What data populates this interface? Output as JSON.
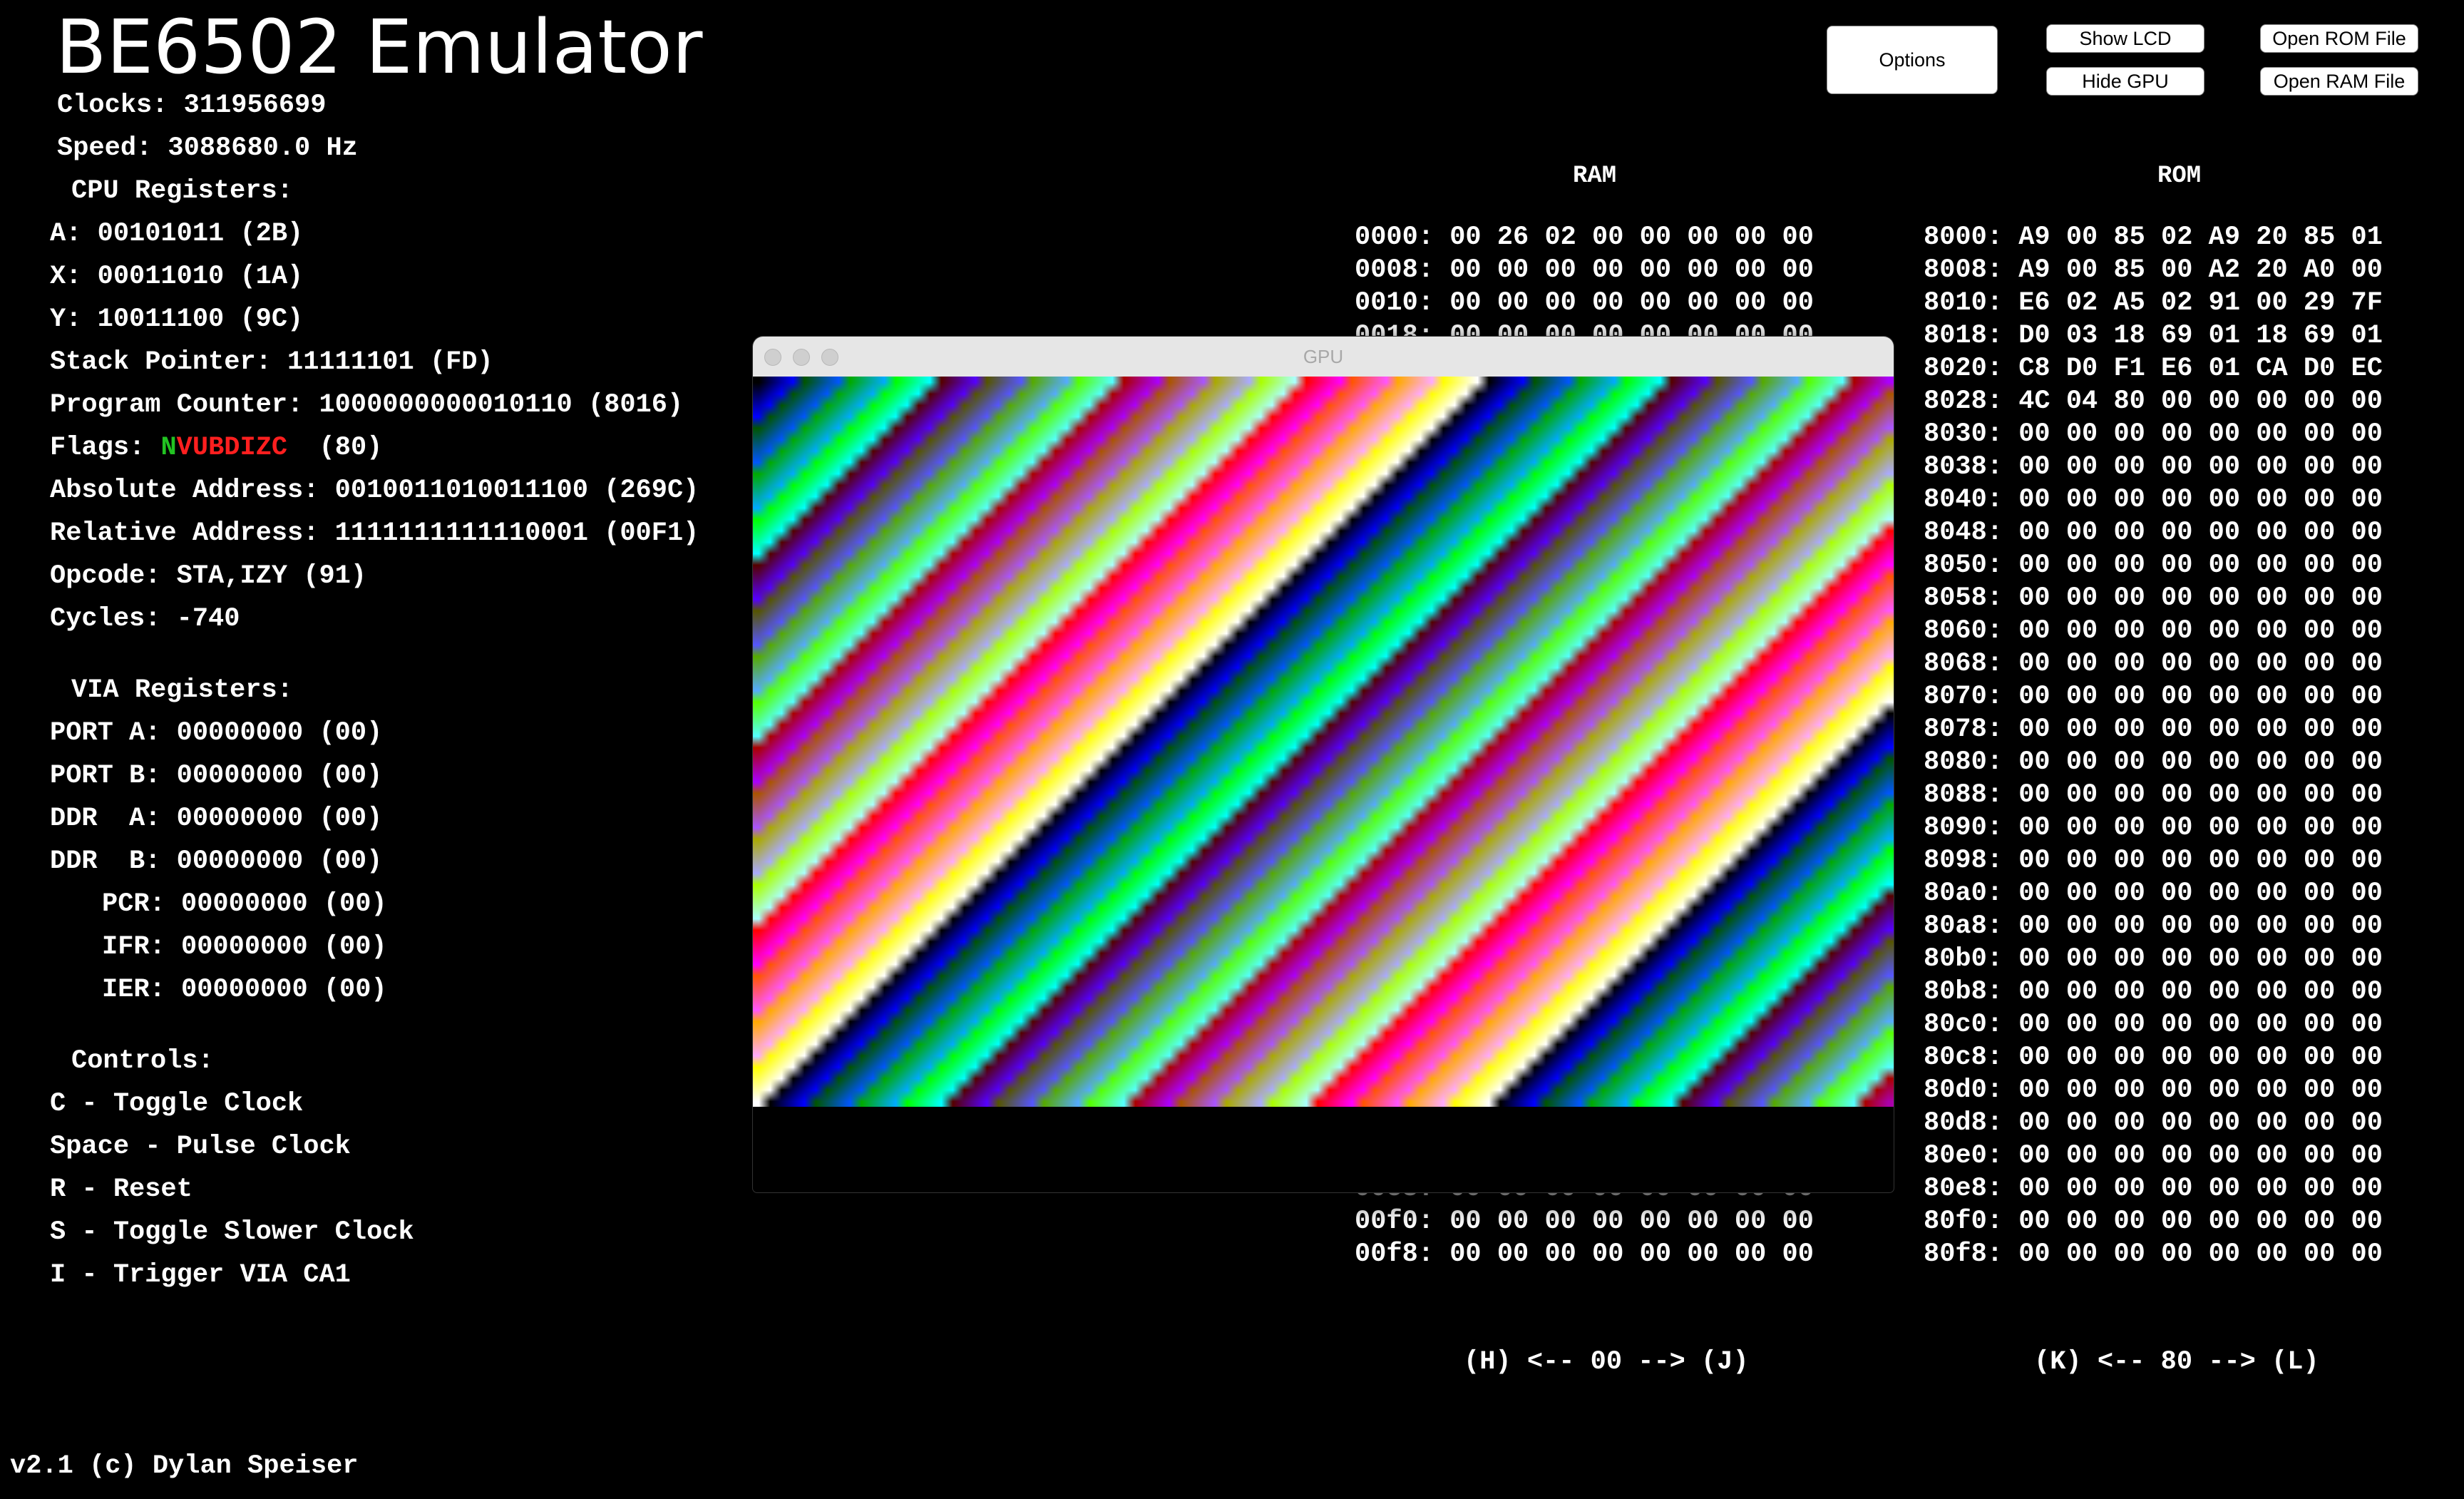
{
  "app": {
    "title": "BE6502 Emulator",
    "clocks_line": "Clocks: 311956699",
    "speed_line": "Speed: 3088680.0 Hz",
    "footer": "v2.1 (c) Dylan Speiser"
  },
  "buttons": {
    "options": "Options",
    "show_lcd": "Show LCD",
    "hide_gpu": "Hide GPU",
    "open_rom": "Open ROM File",
    "open_ram": "Open RAM File"
  },
  "cpu": {
    "heading": "CPU Registers:",
    "a": "A: 00101011 (2B)",
    "x": "X: 00011010 (1A)",
    "y": "Y: 10011100 (9C)",
    "sp": "Stack Pointer: 11111101 (FD)",
    "pc": "Program Counter: 1000000000010110 (8016)",
    "flags_label": "Flags:",
    "flags_set": "N",
    "flags_clear": "VUBDIZC",
    "flags_value": "(80)",
    "flags_set_color": "#22c322",
    "flags_clear_color": "#ff1f1f",
    "abs": "Absolute Address: 0010011010011100 (269C)",
    "rel": "Relative Address: 1111111111110001 (00F1)",
    "opcode": "Opcode: STA,IZY (91)",
    "cycles": "Cycles: -740"
  },
  "via": {
    "heading": "VIA Registers:",
    "port_a": "PORT A: 00000000 (00)",
    "port_b": "PORT B: 00000000 (00)",
    "ddr_a": "DDR  A: 00000000 (00)",
    "ddr_b": "DDR  B: 00000000 (00)",
    "pcr": "PCR: 00000000 (00)",
    "ifr": "IFR: 00000000 (00)",
    "ier": "IER: 00000000 (00)"
  },
  "controls": {
    "heading": "Controls:",
    "items": [
      "C - Toggle Clock",
      "Space - Pulse Clock",
      "R - Reset",
      "S - Toggle Slower Clock",
      "I - Trigger VIA CA1"
    ]
  },
  "ram": {
    "title": "RAM",
    "rows": [
      "0000: 00 26 02 00 00 00 00 00",
      "0008: 00 00 00 00 00 00 00 00",
      "0010: 00 00 00 00 00 00 00 00",
      "0018: 00 00 00 00 00 00 00 00",
      "",
      "",
      "",
      "",
      "",
      "",
      "",
      "",
      "",
      "",
      "",
      "",
      "",
      "",
      "",
      "",
      "",
      "",
      "",
      "",
      "",
      "",
      "",
      "",
      "",
      "00e8: 00 00 00 00 00 00 00 00",
      "00f0: 00 00 00 00 00 00 00 00",
      "00f8: 00 00 00 00 00 00 00 00"
    ],
    "nav": "(H) <-- 00 --> (J)"
  },
  "rom": {
    "title": "ROM",
    "rows": [
      "8000: A9 00 85 02 A9 20 85 01",
      "8008: A9 00 85 00 A2 20 A0 00",
      "8010: E6 02 A5 02 91 00 29 7F",
      "8018: D0 03 18 69 01 18 69 01",
      "8020: C8 D0 F1 E6 01 CA D0 EC",
      "8028: 4C 04 80 00 00 00 00 00",
      "8030: 00 00 00 00 00 00 00 00",
      "8038: 00 00 00 00 00 00 00 00",
      "8040: 00 00 00 00 00 00 00 00",
      "8048: 00 00 00 00 00 00 00 00",
      "8050: 00 00 00 00 00 00 00 00",
      "8058: 00 00 00 00 00 00 00 00",
      "8060: 00 00 00 00 00 00 00 00",
      "8068: 00 00 00 00 00 00 00 00",
      "8070: 00 00 00 00 00 00 00 00",
      "8078: 00 00 00 00 00 00 00 00",
      "8080: 00 00 00 00 00 00 00 00",
      "8088: 00 00 00 00 00 00 00 00",
      "8090: 00 00 00 00 00 00 00 00",
      "8098: 00 00 00 00 00 00 00 00",
      "80a0: 00 00 00 00 00 00 00 00",
      "80a8: 00 00 00 00 00 00 00 00",
      "80b0: 00 00 00 00 00 00 00 00",
      "80b8: 00 00 00 00 00 00 00 00",
      "80c0: 00 00 00 00 00 00 00 00",
      "80c8: 00 00 00 00 00 00 00 00",
      "80d0: 00 00 00 00 00 00 00 00",
      "80d8: 00 00 00 00 00 00 00 00",
      "80e0: 00 00 00 00 00 00 00 00",
      "80e8: 00 00 00 00 00 00 00 00",
      "80f0: 00 00 00 00 00 00 00 00",
      "80f8: 00 00 00 00 00 00 00 00"
    ],
    "nav": "(K) <-- 80 --> (L)"
  },
  "gpu": {
    "title": "GPU"
  }
}
